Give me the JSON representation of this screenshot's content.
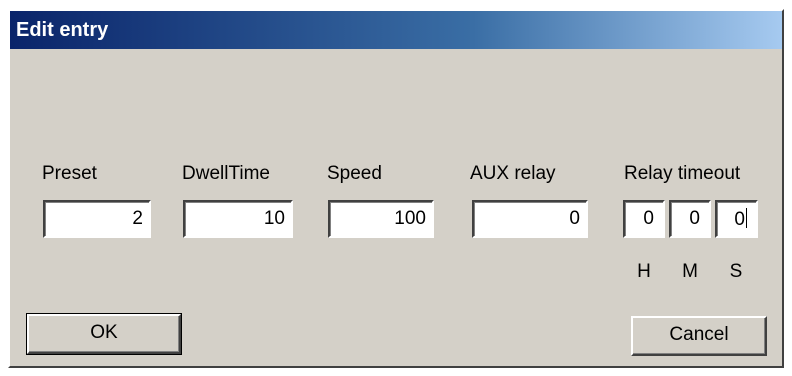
{
  "dialog": {
    "title": "Edit entry"
  },
  "fields": {
    "preset": {
      "label": "Preset",
      "value": "2"
    },
    "dwell_time": {
      "label": "DwellTime",
      "value": "10"
    },
    "speed": {
      "label": "Speed",
      "value": "100"
    },
    "aux_relay": {
      "label": "AUX relay",
      "value": "0"
    },
    "relay_timeout": {
      "label": "Relay timeout",
      "hours": "0",
      "minutes": "0",
      "seconds": "0",
      "unit_h": "H",
      "unit_m": "M",
      "unit_s": "S"
    }
  },
  "buttons": {
    "ok": "OK",
    "cancel": "Cancel"
  },
  "colors": {
    "title_gradient_start": "#0a246a",
    "title_gradient_end": "#a6caf0",
    "face": "#d4d0c8"
  }
}
